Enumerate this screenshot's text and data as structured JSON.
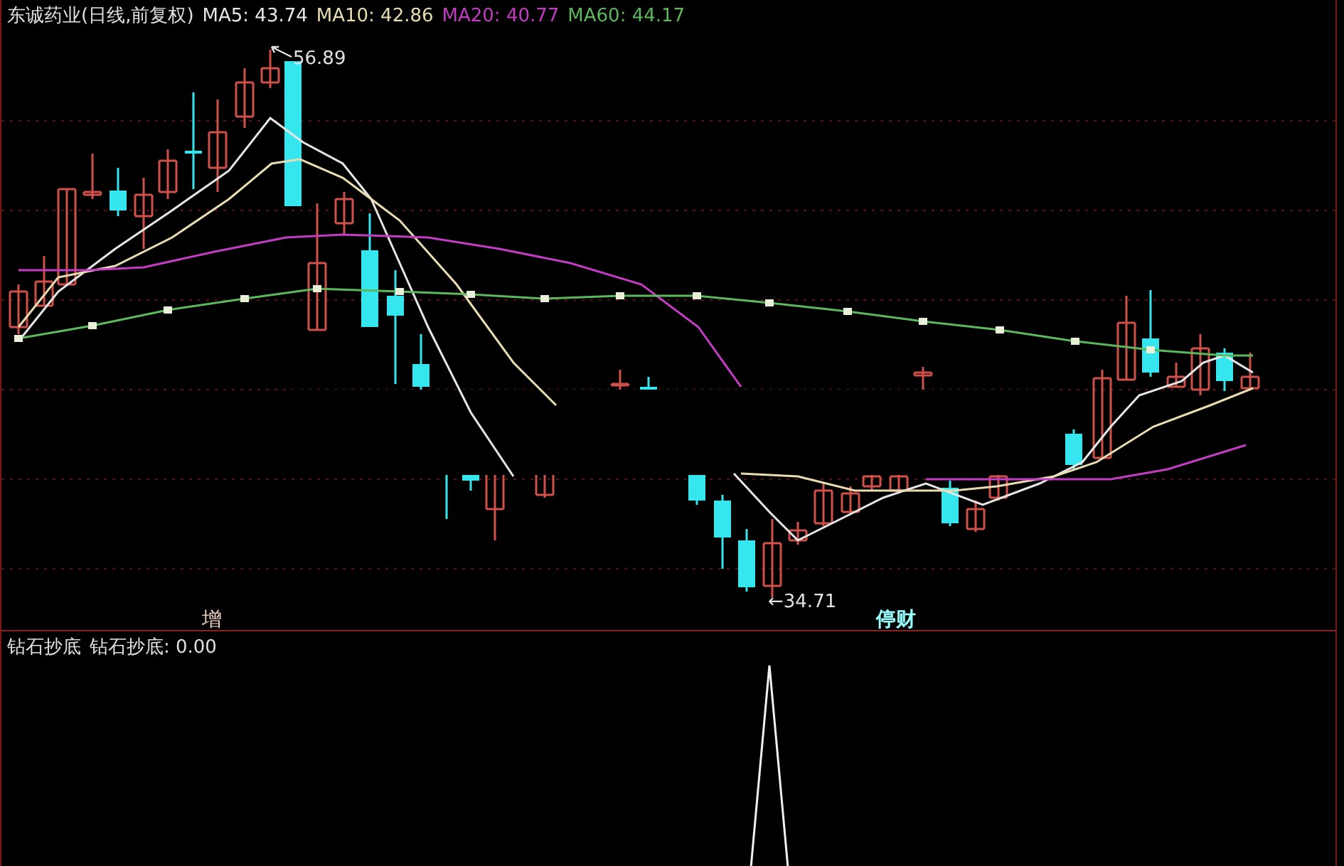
{
  "title": "东诚药业(日线,前复权)",
  "ma_lines": [
    {
      "label": "MA5:",
      "value": "43.74",
      "color": "#e6e6e6"
    },
    {
      "label": "MA10:",
      "value": "42.86",
      "color": "#e8dcb0"
    },
    {
      "label": "MA20:",
      "value": "40.77",
      "color": "#c43cc4"
    },
    {
      "label": "MA60:",
      "value": "44.17",
      "color": "#5cb85c"
    }
  ],
  "price_marks": [
    {
      "kind": "high",
      "text": "56.89"
    },
    {
      "kind": "low",
      "text": "←34.71"
    }
  ],
  "signals": [
    {
      "text": "增",
      "highlighted": false
    },
    {
      "text": "停财",
      "highlighted": true
    }
  ],
  "indicator": {
    "name": "钻石抄底",
    "label": "钻石抄底:",
    "value": "0.00"
  }
}
